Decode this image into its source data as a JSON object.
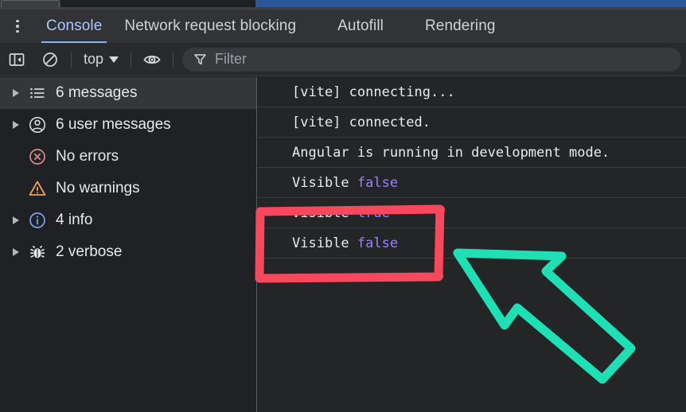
{
  "window": {
    "chrome_strip": "browser-tab-strip-sliver",
    "blue_bar_color": "#2b5797"
  },
  "tabbar": {
    "menu_icon": "kebab-menu-icon",
    "tabs": [
      {
        "label": "Console",
        "active": true
      },
      {
        "label": "Network request blocking",
        "active": false
      },
      {
        "label": "Autofill",
        "active": false
      },
      {
        "label": "Rendering",
        "active": false
      }
    ],
    "active_underline_color": "#8ab4f8"
  },
  "toolbar": {
    "sidebar_toggle_icon": "sidebar-panel-icon",
    "clear_console_icon": "clear-console-icon",
    "context_selector": {
      "value": "top",
      "caret_icon": "chevron-down-icon"
    },
    "eye_icon": "eye-icon",
    "filter": {
      "icon": "filter-funnel-icon",
      "placeholder": "Filter",
      "value": ""
    }
  },
  "sidebar": {
    "items": [
      {
        "label": "6 messages",
        "icon": "list-icon",
        "expandable": true,
        "selected": true
      },
      {
        "label": "6 user messages",
        "icon": "user-icon",
        "expandable": true,
        "selected": false
      },
      {
        "label": "No errors",
        "icon": "error-icon",
        "expandable": false,
        "selected": false
      },
      {
        "label": "No warnings",
        "icon": "warning-icon",
        "expandable": false,
        "selected": false
      },
      {
        "label": "4 info",
        "icon": "info-icon",
        "expandable": true,
        "selected": false
      },
      {
        "label": "2 verbose",
        "icon": "bug-icon",
        "expandable": true,
        "selected": false
      }
    ],
    "colors": {
      "error": "#d98a8a",
      "warning": "#e8a35c",
      "info": "#7aa5f0",
      "verbose": "#e8eaed"
    }
  },
  "console": {
    "messages": [
      {
        "text": "[vite] connecting...",
        "bool": ""
      },
      {
        "text": "[vite] connected.",
        "bool": ""
      },
      {
        "text": "Angular is running in development mode.",
        "bool": ""
      },
      {
        "text": "Visible ",
        "bool": "false"
      },
      {
        "text": "Visible ",
        "bool": "true"
      },
      {
        "text": "Visible ",
        "bool": "false"
      }
    ],
    "boolean_color": "#9a7fff"
  },
  "annotations": {
    "highlight_box": {
      "shape": "hand-drawn-rectangle",
      "color": "#f8485e",
      "targets": "Visible false (last)"
    },
    "arrow": {
      "shape": "hand-drawn-outline-arrow",
      "color": "#1fdfb4",
      "direction": "up-left"
    }
  }
}
